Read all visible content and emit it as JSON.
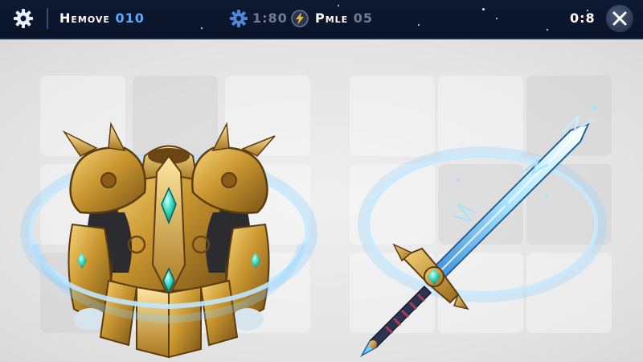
{
  "hud": {
    "settings_icon": "gear-icon",
    "primary_stat": {
      "label": "Hemove",
      "value": "010",
      "color": "#5aa8ff"
    },
    "resource_1": {
      "icon": "gear-coin-icon",
      "value": "1:80"
    },
    "resource_2": {
      "icon": "lightning-icon",
      "label": "Pmle",
      "value": "05"
    },
    "timer": "0:8",
    "close_icon": "close-icon"
  },
  "items": [
    {
      "name": "golden-armor",
      "icon": "armor-icon",
      "aura_color": "#7cc9ff"
    },
    {
      "name": "ice-sword",
      "icon": "sword-icon",
      "aura_color": "#7cc9ff"
    }
  ],
  "colors": {
    "topbar": "#0e1a33",
    "gold": "#c9962f",
    "gem": "#2fd6c0",
    "blade": "#6fd0ff",
    "background": "#e6e6e6"
  }
}
